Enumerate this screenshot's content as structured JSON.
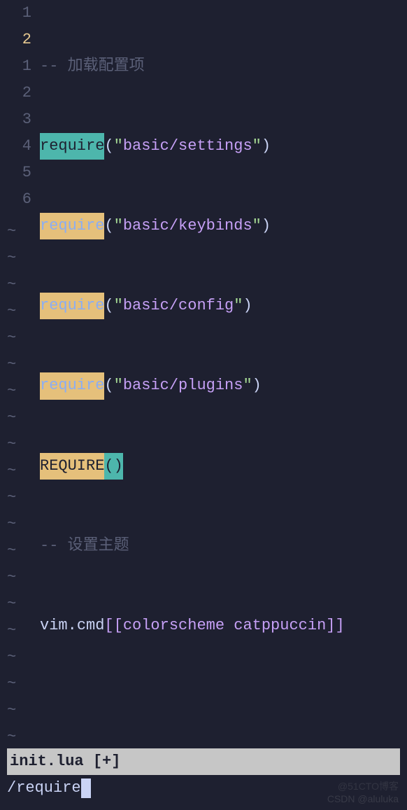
{
  "gutter": {
    "l1": "1",
    "l2": "2",
    "l3": "1",
    "l4": "2",
    "l5": "3",
    "l6": "4",
    "l7": "5",
    "l8": "6"
  },
  "code": {
    "comment1": "-- 加载配置项",
    "require": "require",
    "REQUIRE": "REQUIRE",
    "open": "(",
    "close": ")",
    "q": "\"",
    "str_settings": "basic/settings",
    "str_keybinds": "basic/keybinds",
    "str_config": "basic/config",
    "str_plugins": "basic/plugins",
    "empty_parens": "()",
    "comment2": "-- 设置主题",
    "vim": "vim",
    "dot": ".",
    "cmd": "cmd",
    "cs_brackets": "[[colorscheme catppuccin]]"
  },
  "tilde": "~",
  "status": "init.lua [+]",
  "cmdline": "/require",
  "watermark1": "CSDN @aluluka",
  "watermark2": "@51CTO博客"
}
